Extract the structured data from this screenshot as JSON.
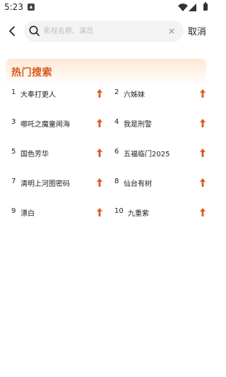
{
  "status_bar": {
    "time": "5:23"
  },
  "search": {
    "placeholder": "影视名称、演员",
    "value": "",
    "clear_icon": "×",
    "cancel_label": "取消"
  },
  "hot_search": {
    "title": "热门搜索",
    "accent_color": "#d45a1c",
    "trend_color": "#e2571e",
    "items": [
      {
        "rank": "1",
        "name": "大奉打更人",
        "trend_icon": "up-arrow-icon"
      },
      {
        "rank": "2",
        "name": "六姊妹",
        "trend_icon": "up-arrow-icon"
      },
      {
        "rank": "3",
        "name": "哪吒之魔童闹海",
        "trend_icon": "up-arrow-icon"
      },
      {
        "rank": "4",
        "name": "我是刑警",
        "trend_icon": "up-arrow-icon"
      },
      {
        "rank": "5",
        "name": "国色芳华",
        "trend_icon": "up-arrow-icon"
      },
      {
        "rank": "6",
        "name": "五福临门2025",
        "trend_icon": "up-arrow-icon"
      },
      {
        "rank": "7",
        "name": "清明上河图密码",
        "trend_icon": "up-arrow-icon"
      },
      {
        "rank": "8",
        "name": "仙台有树",
        "trend_icon": "up-arrow-icon"
      },
      {
        "rank": "9",
        "name": "漂白",
        "trend_icon": "up-arrow-icon"
      },
      {
        "rank": "10",
        "name": "九重紫",
        "trend_icon": "up-arrow-icon"
      }
    ]
  }
}
